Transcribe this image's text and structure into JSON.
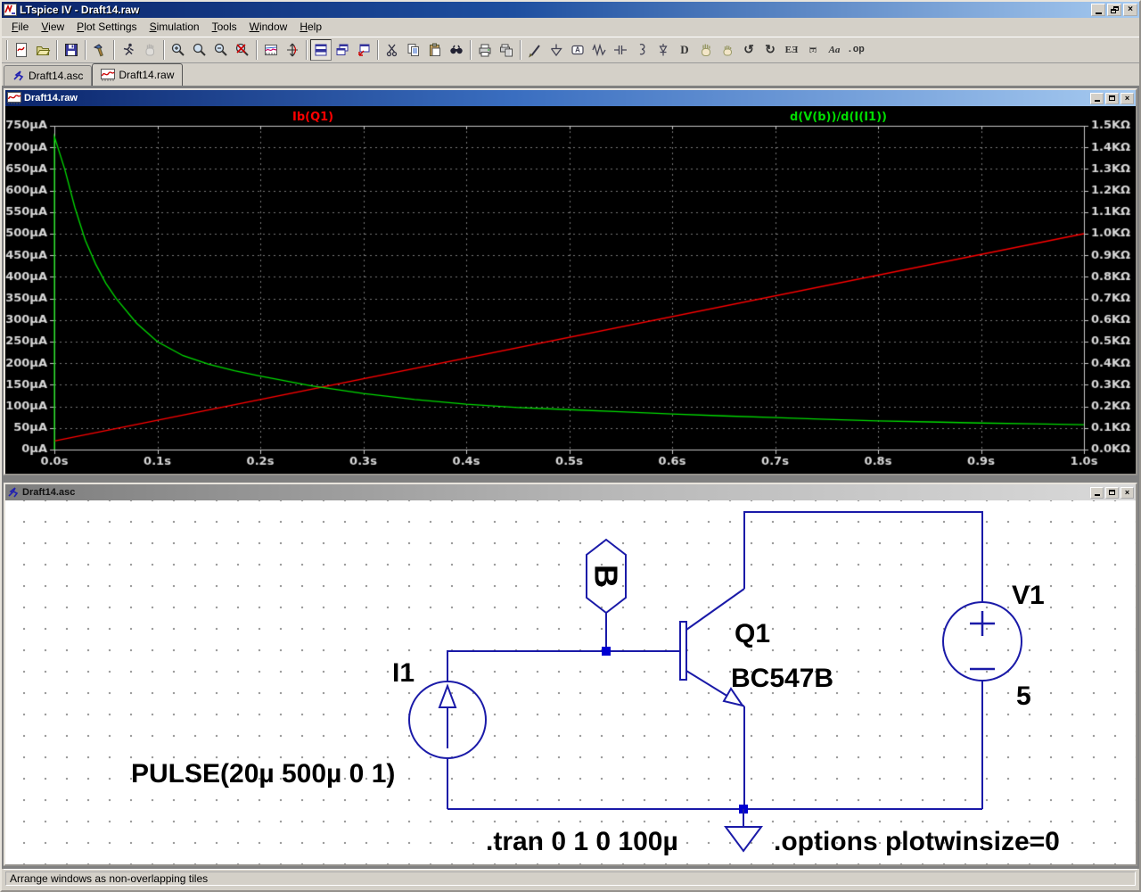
{
  "window": {
    "title": "LTspice IV - Draft14.raw",
    "controls": [
      "minimize",
      "restore",
      "close"
    ]
  },
  "menu": {
    "items": [
      "File",
      "View",
      "Plot Settings",
      "Simulation",
      "Tools",
      "Window",
      "Help"
    ]
  },
  "toolbar": {
    "icons": [
      "new-schematic",
      "open",
      "save",
      "control-panel",
      "run",
      "halt",
      "zoom-in",
      "zoom-box",
      "zoom-out",
      "zoom-full-extents",
      "plot-settings",
      "autorange-y",
      "tile-horizontal",
      "cascade",
      "tile-vertical",
      "cut",
      "copy",
      "paste",
      "find",
      "print",
      "print-preview",
      "wire",
      "ground",
      "label-net",
      "resistor",
      "capacitor",
      "inductor",
      "diode",
      "component",
      "move",
      "drag",
      "undo",
      "redo",
      "mirror",
      "rotate",
      "text",
      "spice-directive"
    ],
    "glyphs": {
      "undo": "↺",
      "redo": "↻",
      "mirror": "EƎ",
      "rotate": "E",
      "text": "Aa",
      "component": "D",
      "directive": ".op"
    }
  },
  "tabs": [
    {
      "label": "Draft14.asc",
      "icon": "schematic-icon",
      "active": false
    },
    {
      "label": "Draft14.raw",
      "icon": "waveform-icon",
      "active": true
    }
  ],
  "plot_window": {
    "title": "Draft14.raw"
  },
  "chart_data": {
    "type": "line",
    "background": "#000000",
    "grid": true,
    "grid_color": "#787878",
    "axis_color": "#c8c8c8",
    "tick_text_color": "#d8d8d8",
    "x": {
      "unit": "s",
      "min": 0,
      "max": 1,
      "ticks": [
        "0.0s",
        "0.1s",
        "0.2s",
        "0.3s",
        "0.4s",
        "0.5s",
        "0.6s",
        "0.7s",
        "0.8s",
        "0.9s",
        "1.0s"
      ]
    },
    "y_left": {
      "unit": "µA",
      "min": 0,
      "max": 750,
      "ticks": [
        "750µA",
        "700µA",
        "650µA",
        "600µA",
        "550µA",
        "500µA",
        "450µA",
        "400µA",
        "350µA",
        "300µA",
        "250µA",
        "200µA",
        "150µA",
        "100µA",
        "50µA",
        "0µA"
      ]
    },
    "y_right": {
      "unit": "KΩ",
      "min": 0,
      "max": 1.5,
      "ticks": [
        "1.5KΩ",
        "1.4KΩ",
        "1.3KΩ",
        "1.2KΩ",
        "1.1KΩ",
        "1.0KΩ",
        "0.9KΩ",
        "0.8KΩ",
        "0.7KΩ",
        "0.6KΩ",
        "0.5KΩ",
        "0.4KΩ",
        "0.3KΩ",
        "0.2KΩ",
        "0.1KΩ",
        "0.0KΩ"
      ]
    },
    "series": [
      {
        "name": "Ib(Q1)",
        "color": "#ff0000",
        "axis": "left",
        "points": [
          [
            0,
            20
          ],
          [
            1,
            500
          ]
        ]
      },
      {
        "name": "d(V(b))/d(I(I1))",
        "color": "#00dc00",
        "axis": "right",
        "points": [
          [
            0,
            0
          ],
          [
            0,
            1.45
          ],
          [
            0.01,
            1.3
          ],
          [
            0.02,
            1.12
          ],
          [
            0.03,
            0.97
          ],
          [
            0.04,
            0.86
          ],
          [
            0.05,
            0.77
          ],
          [
            0.06,
            0.7
          ],
          [
            0.08,
            0.585
          ],
          [
            0.1,
            0.5
          ],
          [
            0.125,
            0.435
          ],
          [
            0.15,
            0.395
          ],
          [
            0.175,
            0.365
          ],
          [
            0.2,
            0.34
          ],
          [
            0.25,
            0.295
          ],
          [
            0.3,
            0.26
          ],
          [
            0.35,
            0.232
          ],
          [
            0.4,
            0.21
          ],
          [
            0.45,
            0.195
          ],
          [
            0.5,
            0.185
          ],
          [
            0.55,
            0.175
          ],
          [
            0.6,
            0.165
          ],
          [
            0.65,
            0.156
          ],
          [
            0.7,
            0.148
          ],
          [
            0.75,
            0.14
          ],
          [
            0.8,
            0.133
          ],
          [
            0.85,
            0.128
          ],
          [
            0.9,
            0.123
          ],
          [
            0.95,
            0.119
          ],
          [
            1.0,
            0.115
          ]
        ]
      }
    ]
  },
  "schematic_window": {
    "title": "Draft14.asc",
    "wire_color": "#1a1aa8",
    "junction_color": "#0000d2",
    "components": {
      "i1_name": "I1",
      "i1_value": "PULSE(20µ 500µ 0 1)",
      "q1_name": "Q1",
      "q1_value": "BC547B",
      "v1_name": "V1",
      "v1_value": "5",
      "net_label": "B"
    },
    "directives": {
      "tran": ".tran 0 1 0 100µ",
      "options": ".options plotwinsize=0"
    }
  },
  "status_bar": {
    "text": "Arrange windows as non-overlapping tiles"
  }
}
